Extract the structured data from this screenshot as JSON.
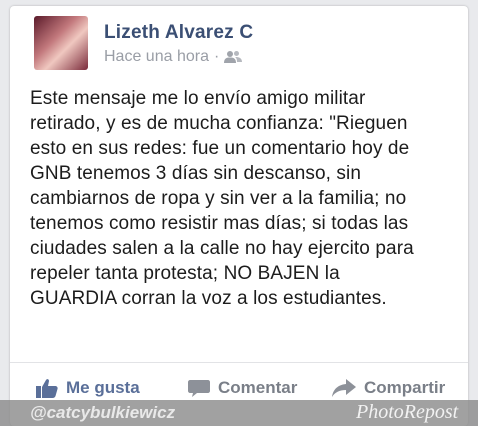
{
  "post": {
    "author": "Lizeth Alvarez C",
    "timestamp": "Hace una hora",
    "separator": "·",
    "audience_icon": "friends-icon",
    "text": "Este mensaje me lo envío amigo militar\nretirado, y es de mucha confianza: \"Rieguen\nesto en sus redes: fue un comentario hoy de\nGNB tenemos 3 días sin descanso, sin\ncambiarnos de ropa y sin ver a la familia; no\ntenemos como resistir mas días; si todas las\nciudades salen a la calle no hay ejercito para\nrepeler tanta protesta; NO BAJEN la\nGUARDIA corran la voz a los estudiantes."
  },
  "actions": {
    "like": {
      "label": "Me gusta",
      "icon": "thumbs-up-icon"
    },
    "comment": {
      "label": "Comentar",
      "icon": "comment-bubble-icon"
    },
    "share": {
      "label": "Compartir",
      "icon": "share-arrow-icon"
    }
  },
  "watermark": {
    "username": "@catcybulkiewicz",
    "brand": "PhotoRepost"
  },
  "colors": {
    "author": "#3b4f74",
    "like_active": "#5a6f99",
    "muted": "#7a7f88",
    "background": "#e9eaed"
  }
}
